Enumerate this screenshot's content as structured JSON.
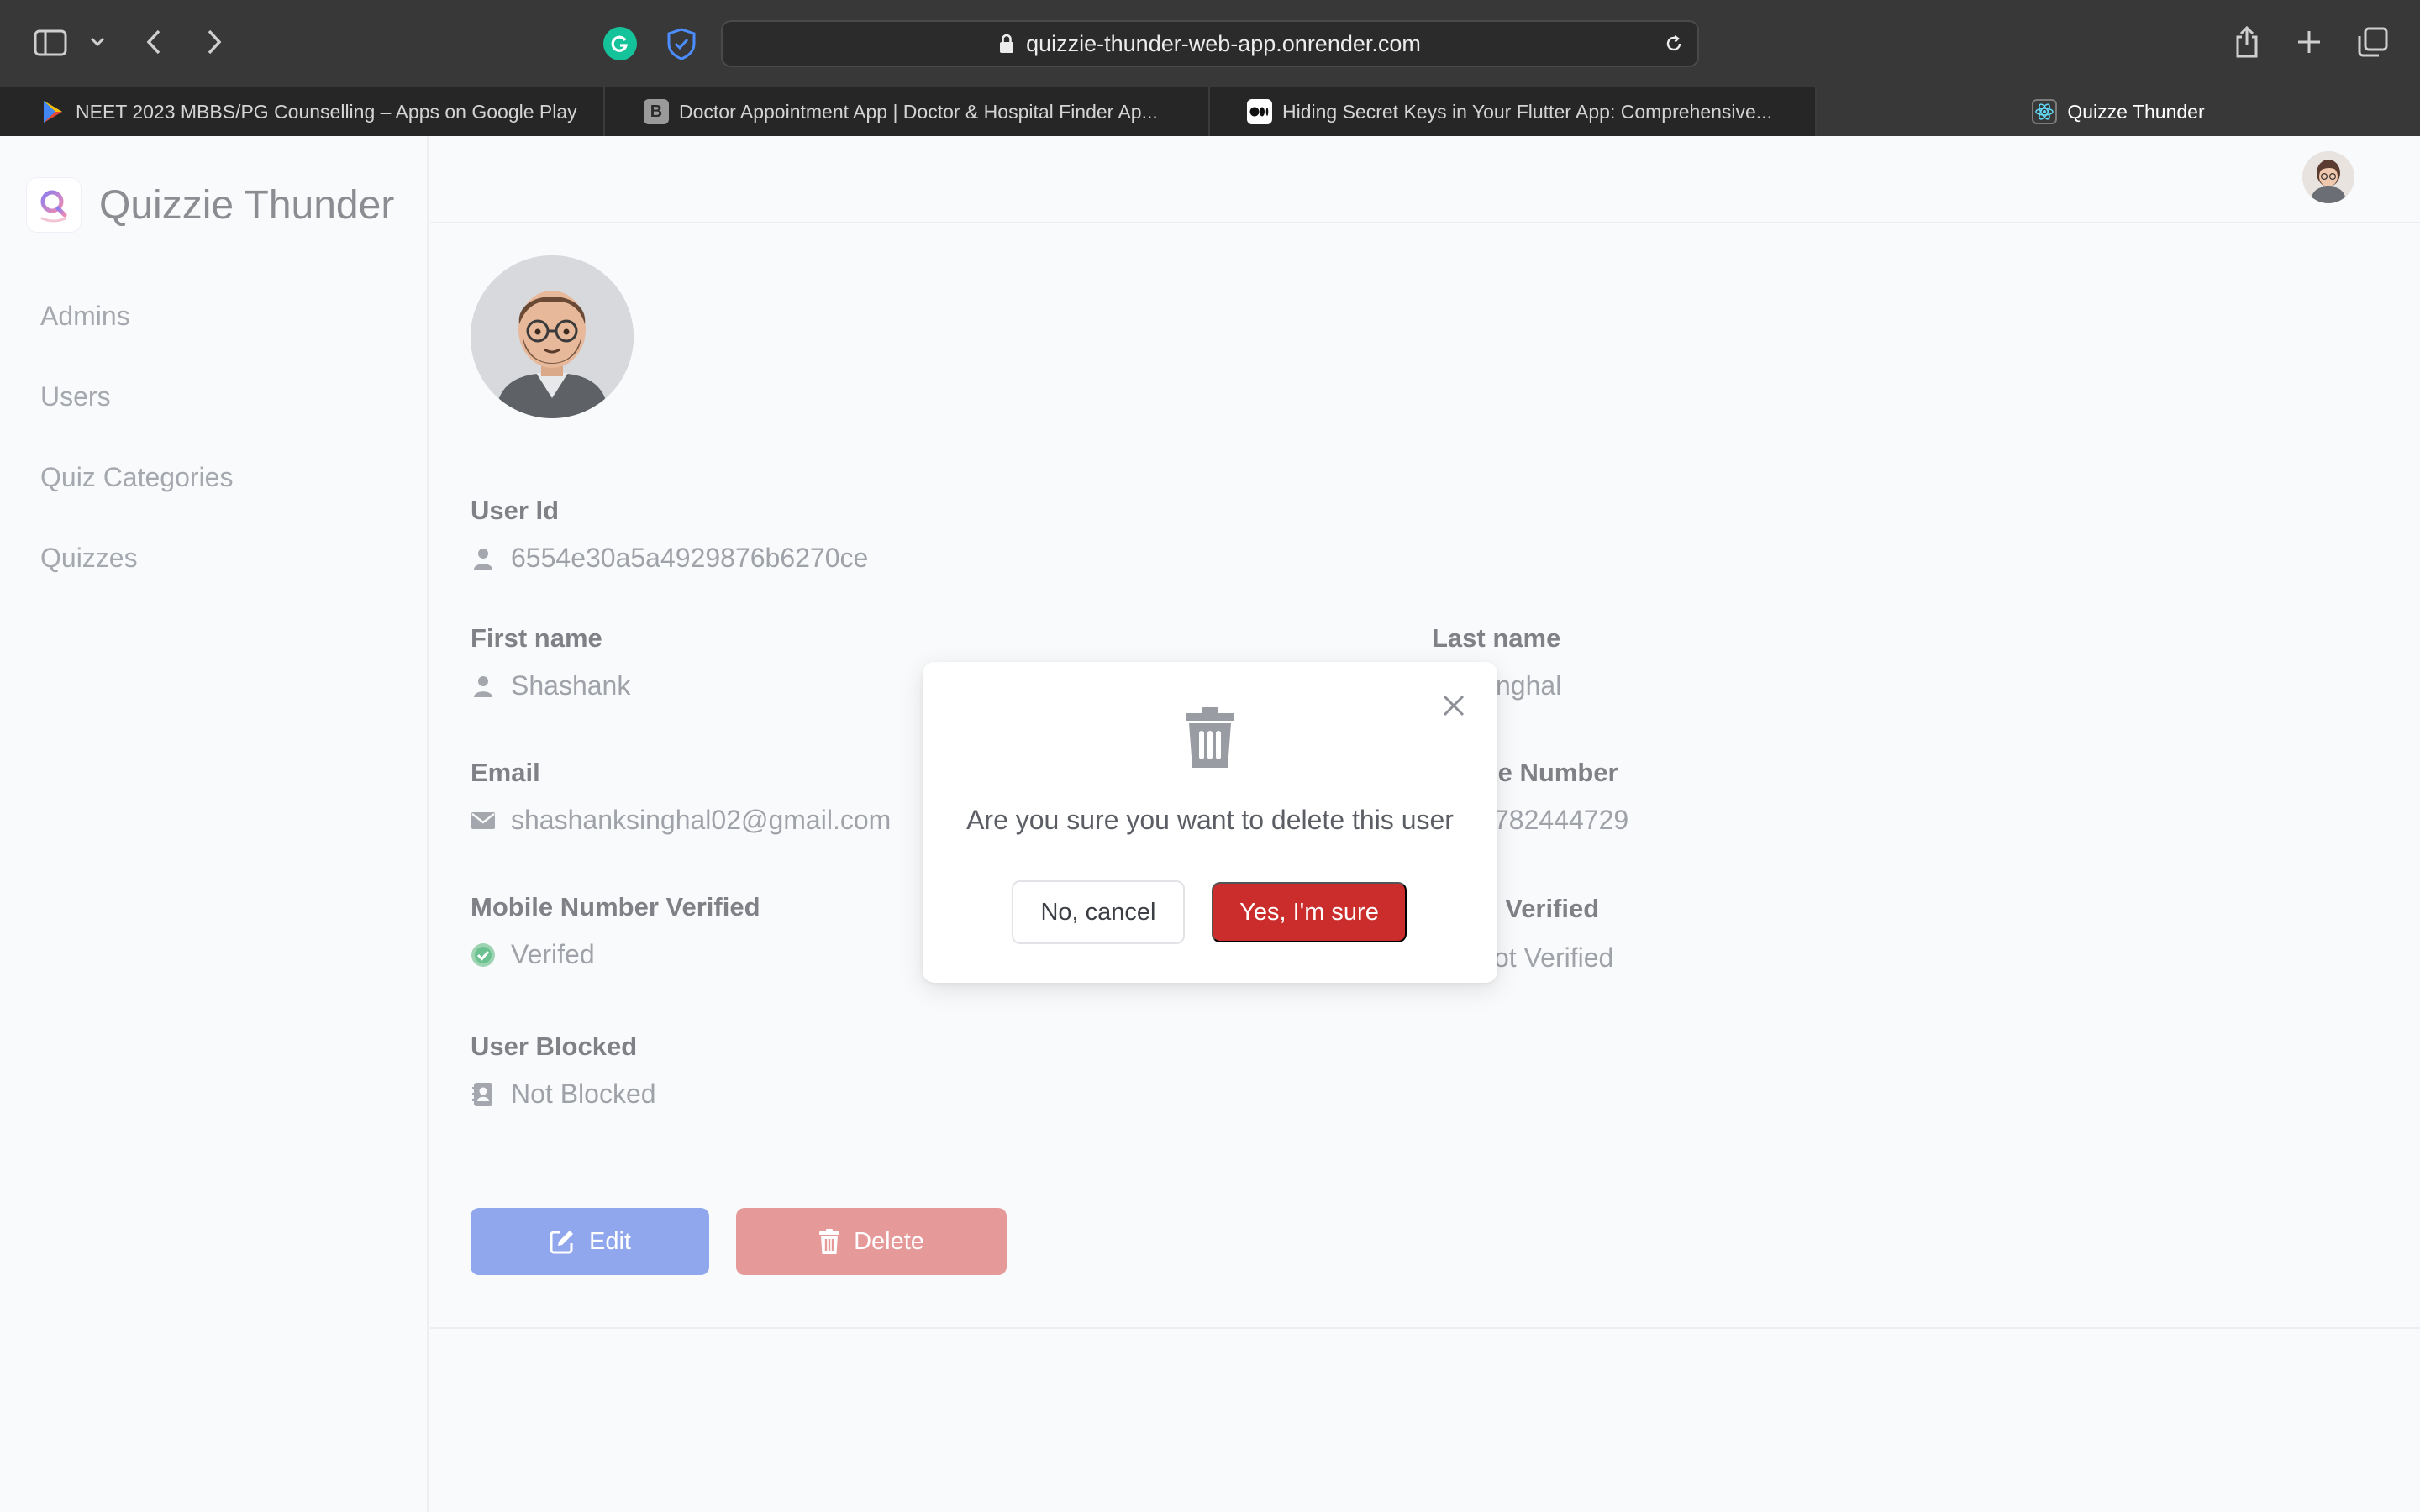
{
  "browser": {
    "url": "quizzie-thunder-web-app.onrender.com",
    "tabs": [
      {
        "label": "NEET 2023 MBBS/PG Counselling – Apps on Google Play",
        "favicon": "google-play-icon"
      },
      {
        "label": "Doctor Appointment App | Doctor & Hospital Finder Ap...",
        "favicon": "b-letter-icon",
        "favicon_text": "B"
      },
      {
        "label": "Hiding Secret Keys in Your Flutter App: Comprehensive...",
        "favicon": "medium-icon"
      },
      {
        "label": "Quizze Thunder",
        "favicon": "react-icon",
        "active": true
      }
    ]
  },
  "app": {
    "brand": "Quizzie Thunder",
    "nav": [
      "Admins",
      "Users",
      "Quiz Categories",
      "Quizzes"
    ]
  },
  "user": {
    "fields": {
      "user_id": {
        "label": "User Id",
        "value": "6554e30a5a4929876b6270ce"
      },
      "first_name": {
        "label": "First name",
        "value": "Shashank"
      },
      "last_name": {
        "label": "Last name",
        "value": "nghal"
      },
      "email": {
        "label": "Email",
        "value": "shashanksinghal02@gmail.com"
      },
      "mobile_number": {
        "label": "le Number",
        "value": "782444729"
      },
      "mobile_verified": {
        "label": "Mobile Number Verified",
        "value": "Verifed"
      },
      "email_verified": {
        "label": "l Verified",
        "value": "ot Verified"
      },
      "blocked": {
        "label": "User Blocked",
        "value": "Not Blocked"
      }
    },
    "actions": {
      "edit": "Edit",
      "delete": "Delete"
    }
  },
  "modal": {
    "message": "Are you sure you want to delete this user",
    "cancel": "No, cancel",
    "confirm": "Yes, I'm sure"
  },
  "colors": {
    "primary": "#90a7ee",
    "danger": "#cb2c2c",
    "danger_faded": "#e59999",
    "verified": "#3fb56b"
  }
}
